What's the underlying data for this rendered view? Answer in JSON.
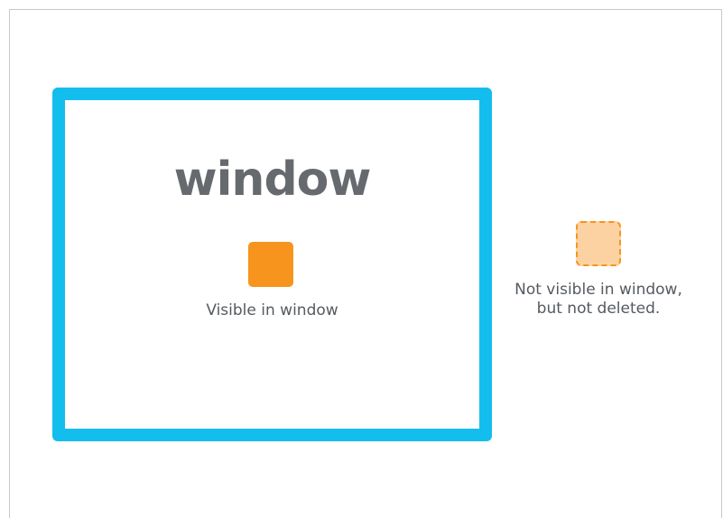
{
  "window": {
    "title": "window",
    "visible_item_label": "Visible in window"
  },
  "outside": {
    "label_line1": "Not visible in window,",
    "label_line2": "but not deleted."
  },
  "colors": {
    "window_border": "#13bdee",
    "item_fill": "#f7941d",
    "ghost_fill": "#fdd2a2",
    "ghost_border": "#f7941d",
    "text": "#555a60"
  }
}
